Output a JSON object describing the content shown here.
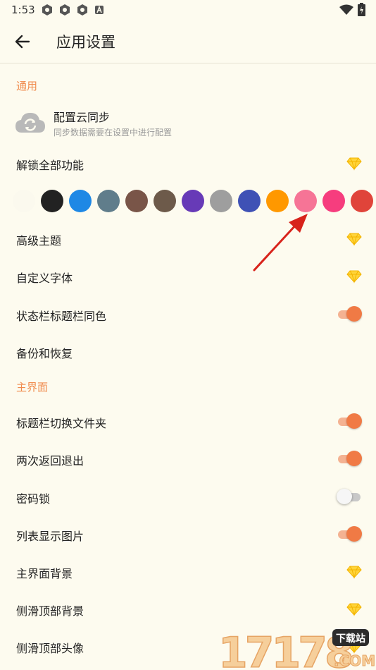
{
  "status": {
    "time": "1:53"
  },
  "header": {
    "title": "应用设置"
  },
  "sections": {
    "general": "通用",
    "main_ui": "主界面"
  },
  "sync": {
    "title": "配置云同步",
    "subtitle": "同步数据需要在设置中进行配置"
  },
  "rows": {
    "unlock": "解锁全部功能",
    "advanced_theme": "高级主题",
    "custom_font": "自定义字体",
    "statusbar_same_color": "状态栏标题栏同色",
    "backup_restore": "备份和恢复",
    "title_switch_folder": "标题栏切换文件夹",
    "double_back_exit": "两次返回退出",
    "password_lock": "密码锁",
    "list_show_images": "列表显示图片",
    "main_background": "主界面背景",
    "drawer_top_background": "侧滑顶部背景",
    "drawer_top_avatar": "侧滑顶部头像"
  },
  "toggles": {
    "statusbar_same_color": true,
    "title_switch_folder": true,
    "double_back_exit": true,
    "password_lock": false,
    "list_show_images": true
  },
  "colors": {
    "accent": "#f08a4b",
    "swatches": [
      "#fbf9ee",
      "#222222",
      "#1e88e5",
      "#607d8b",
      "#795548",
      "#6d5a4a",
      "#673ab7",
      "#9e9e9e",
      "#3f51b5",
      "#ff9800",
      "#f67496",
      "#f63d7e",
      "#e0443a"
    ]
  },
  "watermark": {
    "text": "17178",
    "badge": "下载站",
    "domain": ".COM"
  },
  "icons": {
    "back": "arrow-left-icon",
    "gem": "diamond-icon",
    "cloud": "cloud-sync-icon",
    "annotation": "red-arrow-icon"
  }
}
